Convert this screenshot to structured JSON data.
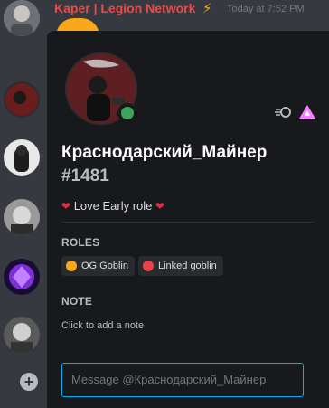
{
  "background_chat": {
    "author_name": "Kaper | Legion Network",
    "timestamp": "Today at 7:52 PM"
  },
  "popout": {
    "username": "Краснодарский_Майнер",
    "discriminator": "#1481",
    "about_me": "Love Early role",
    "status": "online",
    "roles_title": "ROLES",
    "roles": [
      {
        "name": "OG Goblin",
        "color": "#faa81a"
      },
      {
        "name": "Linked goblin",
        "color": "#ed4245"
      }
    ],
    "note_title": "NOTE",
    "note_placeholder": "Click to add a note",
    "message_placeholder": "Message @Краснодарский_Майнер"
  },
  "colors": {
    "accent": "#00b0f4",
    "online": "#3ba55c",
    "author": "#f04747"
  },
  "icons": [
    "lightning-icon",
    "nitro-badge-icon",
    "hypesquad-badge-icon",
    "heart-icon",
    "plus-icon"
  ]
}
